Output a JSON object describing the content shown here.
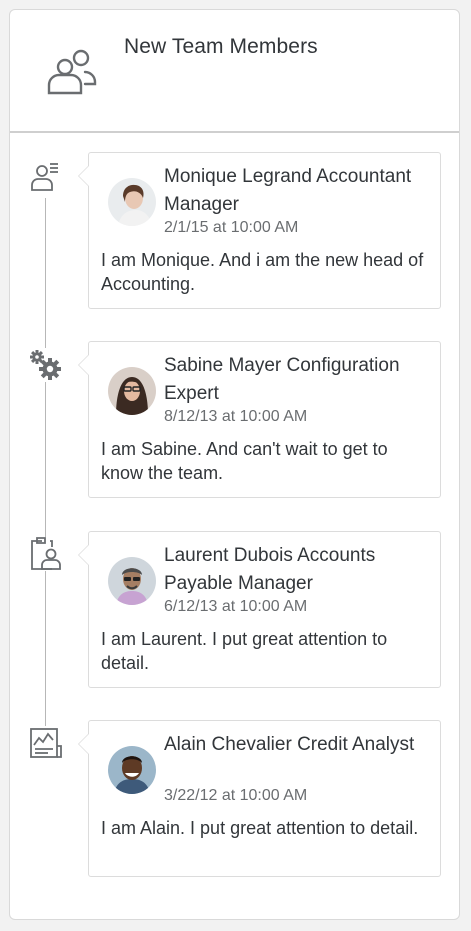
{
  "header": {
    "title": "New Team Members",
    "icon": "group-icon"
  },
  "colors": {
    "icon": "#6a6d70",
    "text": "#32363a",
    "muted": "#6a6d70",
    "line": "#b7b7b7"
  },
  "posts": [
    {
      "icon": "employee-list-icon",
      "name": "Monique Legrand Accountant Manager",
      "date": "2/1/15 at 10:00 AM",
      "text": "I am Monique. And i am the new head of Accounting."
    },
    {
      "icon": "settings-gears-icon",
      "name": "Sabine Mayer Configuration Expert",
      "date": "8/12/13 at 10:00 AM",
      "text": "I am Sabine. And can't wait to get to know the team."
    },
    {
      "icon": "clipboard-person-icon",
      "name": "Laurent Dubois Accounts Payable Manager",
      "date": "6/12/13 at 10:00 AM",
      "text": "I am Laurent. I put great attention to detail."
    },
    {
      "icon": "report-chart-icon",
      "name": "Alain Chevalier Credit Analyst",
      "date": "3/22/12 at 10:00 AM",
      "text": "I am Alain. I put great attention to detail."
    }
  ]
}
